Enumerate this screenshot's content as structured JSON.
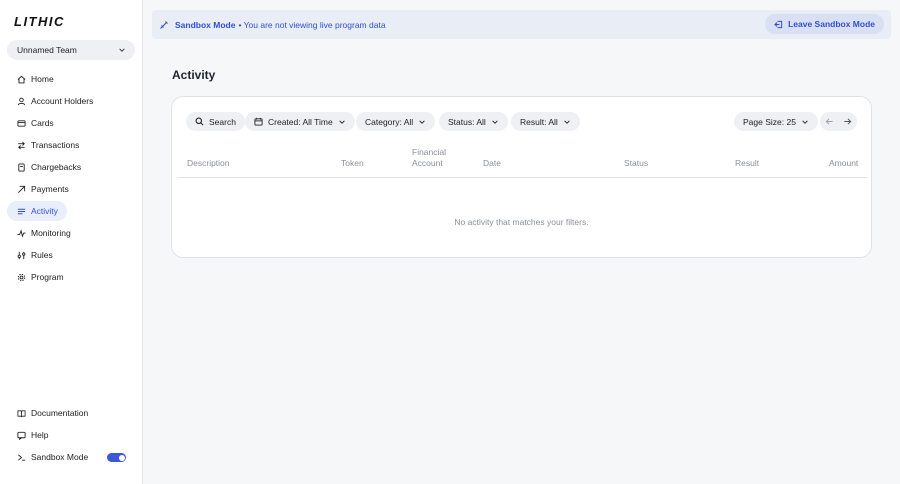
{
  "sidebar": {
    "logo": "LITHIC",
    "team": "Unnamed Team",
    "items": [
      {
        "label": "Home",
        "icon": "home-icon"
      },
      {
        "label": "Account Holders",
        "icon": "user-icon"
      },
      {
        "label": "Cards",
        "icon": "card-icon"
      },
      {
        "label": "Transactions",
        "icon": "transactions-icon"
      },
      {
        "label": "Chargebacks",
        "icon": "chargeback-icon"
      },
      {
        "label": "Payments",
        "icon": "payments-icon"
      },
      {
        "label": "Activity",
        "icon": "activity-icon",
        "active": true
      },
      {
        "label": "Monitoring",
        "icon": "monitoring-icon"
      },
      {
        "label": "Rules",
        "icon": "rules-icon"
      },
      {
        "label": "Program",
        "icon": "gear-icon"
      }
    ],
    "bottom": [
      {
        "label": "Documentation",
        "icon": "book-icon"
      },
      {
        "label": "Help",
        "icon": "help-icon"
      },
      {
        "label": "Sandbox Mode",
        "icon": "sandbox-icon",
        "toggle": true
      }
    ]
  },
  "banner": {
    "mode": "Sandbox Mode",
    "message": "• You are not viewing live program data",
    "leave_label": "Leave Sandbox Mode"
  },
  "main": {
    "title": "Activity",
    "filters": {
      "search": "Search",
      "created": "Created: All Time",
      "category": "Category: All",
      "status": "Status: All",
      "result": "Result: All",
      "page_size": "Page Size: 25"
    },
    "columns": [
      "Description",
      "Token",
      "Financial\nAccount",
      "Date",
      "Status",
      "Result",
      "Amount"
    ],
    "empty_message": "No activity that matches your filters."
  },
  "colors": {
    "accent": "#2f4fd6",
    "banner_bg": "#e9edf5",
    "pill_bg": "#eef0f4"
  }
}
